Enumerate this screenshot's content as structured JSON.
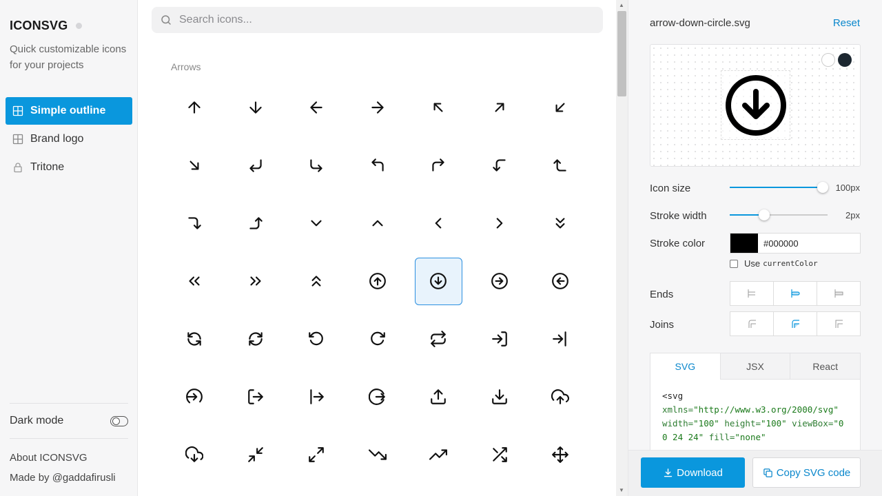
{
  "sidebar": {
    "brand": "ICONSVG",
    "tagline": "Quick customizable icons for your projects",
    "nav": [
      {
        "label": "Simple outline",
        "icon": "grid-icon",
        "active": true
      },
      {
        "label": "Brand logo",
        "icon": "grid-icon",
        "active": false
      },
      {
        "label": "Tritone",
        "icon": "lock-icon",
        "active": false
      }
    ],
    "dark_mode_label": "Dark mode",
    "dark_mode_on": false,
    "about_label": "About ICONSVG",
    "made_by_label": "Made by @gaddafirusli"
  },
  "main": {
    "search_placeholder": "Search icons...",
    "search_value": "",
    "section_label": "Arrows",
    "icons": [
      "arrow-up",
      "arrow-down",
      "arrow-left",
      "arrow-right",
      "arrow-up-left",
      "arrow-up-right",
      "arrow-down-left",
      "arrow-down-right",
      "corner-down-left",
      "corner-down-right",
      "corner-up-left",
      "corner-up-right",
      "corner-left-down",
      "corner-left-up",
      "corner-right-down",
      "corner-right-up",
      "chevron-down",
      "chevron-up",
      "chevron-left",
      "chevron-right",
      "chevrons-down",
      "chevrons-left",
      "chevrons-right",
      "chevrons-up",
      "arrow-up-circle",
      "arrow-down-circle",
      "arrow-right-circle",
      "arrow-left-circle",
      "refresh-ccw",
      "refresh-cw",
      "rotate-ccw",
      "rotate-cw",
      "repeat",
      "log-in",
      "log-in-box",
      "arrow-right-to-line",
      "log-out",
      "log-out-box",
      "arrow-circle-out",
      "upload",
      "download",
      "cloud-upload",
      "cloud-download",
      "minimize",
      "maximize",
      "trending-down",
      "trending-up",
      "shuffle",
      "move"
    ],
    "selected_icon": "arrow-down-circle"
  },
  "panel": {
    "file_name": "arrow-down-circle.svg",
    "reset_label": "Reset",
    "icon_size_label": "Icon size",
    "icon_size_value": "100px",
    "icon_size_fraction": 0.95,
    "stroke_width_label": "Stroke width",
    "stroke_width_value": "2px",
    "stroke_width_fraction": 0.35,
    "stroke_color_label": "Stroke color",
    "stroke_color_value": "#000000",
    "use_current_color_label": "Use",
    "use_current_color_code": "currentColor",
    "ends_label": "Ends",
    "joins_label": "Joins",
    "ends_selected": 1,
    "joins_selected": 1,
    "tabs": [
      "SVG",
      "JSX",
      "React"
    ],
    "active_tab": "SVG",
    "code_lines": {
      "l1": "<svg",
      "l2_attr": "xmlns=",
      "l2_val": "\"http://www.w3.org/2000/svg\"",
      "l3_attr1": "width=",
      "l3_val1": "\"100\"",
      "l3_attr2": " height=",
      "l3_val2": "\"100\"",
      "l3_attr3": " viewBox=",
      "l3_val3": "\"0 0 24 24\"",
      "l3_attr4": " fill=",
      "l3_val4": "\"none\""
    },
    "download_label": "Download",
    "copy_label": "Copy SVG code"
  },
  "colors": {
    "accent": "#0a97dd",
    "link": "#0a87cc",
    "selected_bg": "#e8f3fc"
  }
}
